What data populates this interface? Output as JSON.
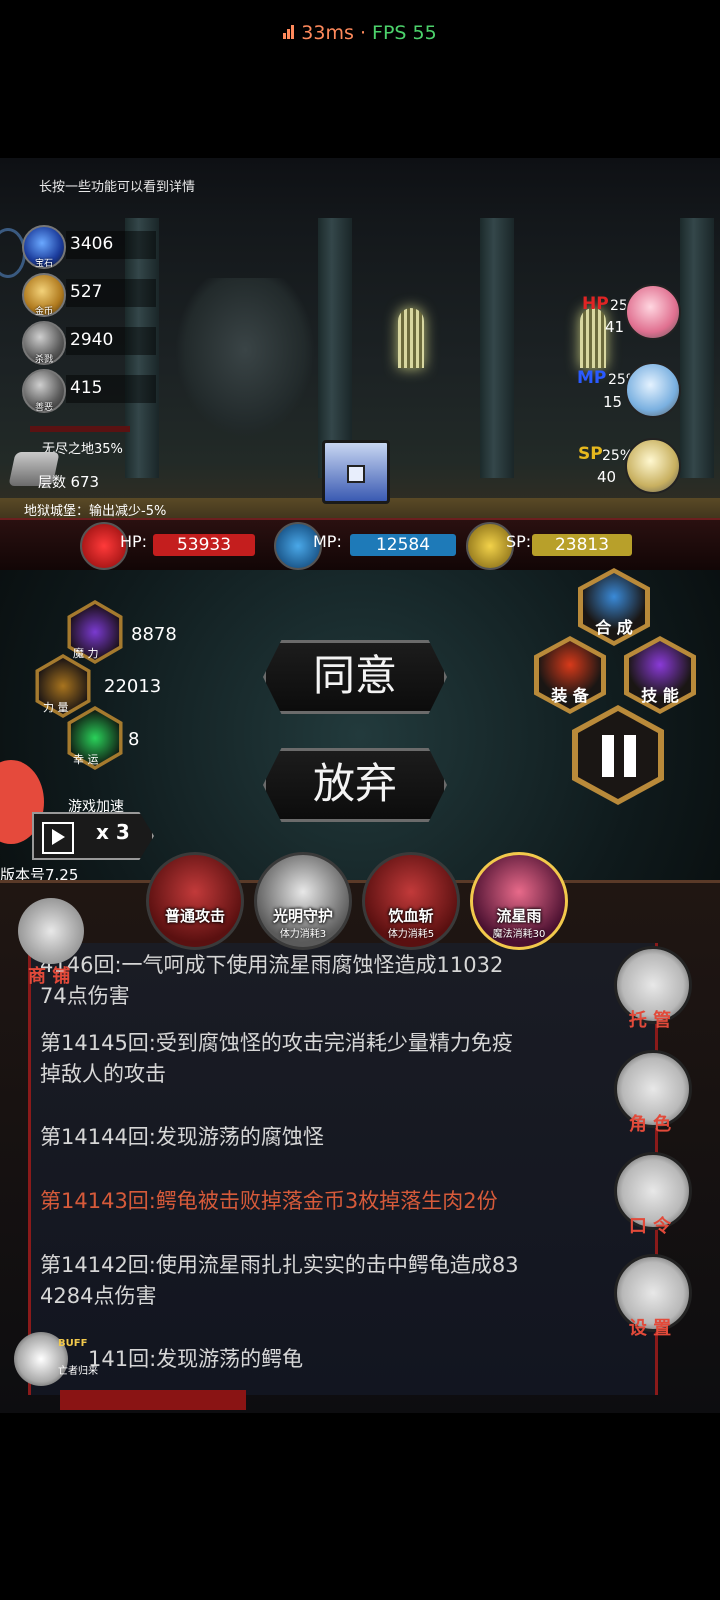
{
  "status": {
    "ping": "33ms",
    "separator": "·",
    "fps": "FPS 55"
  },
  "hint": "长按一些功能可以看到详情",
  "resources": [
    {
      "icon": "crystal-icon",
      "label": "宝石",
      "value": "3406"
    },
    {
      "icon": "gold-coin-icon",
      "label": "金币",
      "value": "527"
    },
    {
      "icon": "skull-icon",
      "label": "杀戮",
      "value": "2940"
    },
    {
      "icon": "mask-icon",
      "label": "善恶",
      "value": "415"
    }
  ],
  "boss_progress": "无尽之地35%",
  "floor": {
    "label": "层数",
    "value": "673"
  },
  "location_buff": "地狱城堡：输出减少-5%",
  "potions": {
    "hp": {
      "label": "HP",
      "pct": "25%",
      "value": "41",
      "color": "#e02424"
    },
    "mp": {
      "label": "MP",
      "pct": "25%",
      "value": "15",
      "color": "#2a5aff"
    },
    "sp": {
      "label": "SP",
      "pct": "25%",
      "value": "40",
      "color": "#e6b81e"
    }
  },
  "stats": {
    "hp": {
      "label": "HP:",
      "value": "53933",
      "color": "#c41e1e"
    },
    "mp": {
      "label": "MP:",
      "value": "12584",
      "color": "#1e7ab8"
    },
    "sp": {
      "label": "SP:",
      "value": "23813",
      "color": "#b8a02a"
    }
  },
  "attributes": [
    {
      "label": "魔 力",
      "value": "8878",
      "icon": "magic-icon"
    },
    {
      "label": "力 量",
      "value": "22013",
      "icon": "strength-icon"
    },
    {
      "label": "幸 运",
      "value": "8",
      "icon": "clover-icon"
    }
  ],
  "actions": {
    "agree": "同意",
    "abandon": "放弃"
  },
  "menu": {
    "synthesize": "合 成",
    "equipment": "装 备",
    "skills": "技 能"
  },
  "speed": {
    "label": "游戏加速",
    "multiplier": "x 3"
  },
  "version": "版本号7.25",
  "skills": [
    {
      "name": "普通攻击",
      "cost": ""
    },
    {
      "name": "光明守护",
      "cost": "体力消耗3"
    },
    {
      "name": "饮血斩",
      "cost": "体力消耗5"
    },
    {
      "name": "流星雨",
      "cost": "魔法消耗30"
    }
  ],
  "shop": "商 铺",
  "log": [
    {
      "text": "第14146回:一气呵成下使用流星雨腐蚀怪造成11032 74点伤害",
      "line1": "4146回:一气呵成下使用流星雨腐蚀怪造成11032",
      "line2": "74点伤害",
      "highlight": false
    },
    {
      "line1": "第14145回:受到腐蚀怪的攻击完消耗少量精力免疫",
      "line2": "掉敌人的攻击",
      "highlight": false
    },
    {
      "line1": "第14144回:发现游荡的腐蚀怪",
      "line2": "",
      "highlight": false
    },
    {
      "line1": "第14143回:鳄龟被击败掉落金币3枚掉落生肉2份",
      "line2": "",
      "highlight": true
    },
    {
      "line1": "第14142回:使用流星雨扎扎实实的击中鳄龟造成83",
      "line2": "4284点伤害",
      "highlight": false
    },
    {
      "line1": "141回:发现游荡的鳄龟",
      "line2": "",
      "highlight": false
    }
  ],
  "side_buttons": [
    {
      "label": "托 管",
      "icon": "dice-icon"
    },
    {
      "label": "角 色",
      "icon": "hooded-figure-icon"
    },
    {
      "label": "口 令",
      "icon": "scroll-icon"
    },
    {
      "label": "设 置",
      "icon": "gear-icon"
    }
  ],
  "buff": {
    "label": "BUFF",
    "sub": "亡者归来"
  }
}
